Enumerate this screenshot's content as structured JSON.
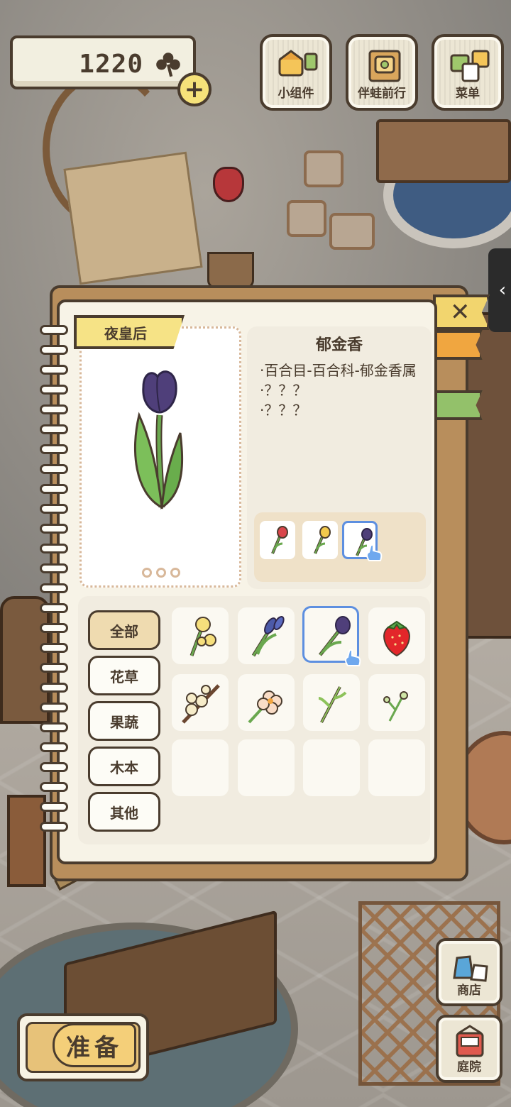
{
  "hud": {
    "clover_count": "1220",
    "plus_label": "+",
    "buttons": [
      {
        "label": "小组件",
        "icon": "widget-icon"
      },
      {
        "label": "伴蛙前行",
        "icon": "frog-journey-icon"
      },
      {
        "label": "菜单",
        "icon": "menu-icon"
      }
    ],
    "side_tab_label": "‹"
  },
  "notebook": {
    "close_label": "✕",
    "flower_name": "夜皇后",
    "info": {
      "title": "郁金香",
      "lines": [
        "·百合目-百合科-郁金香属",
        "·？？？",
        "·？？？"
      ]
    },
    "variants": [
      {
        "name": "red-tulip",
        "color": "#d9464b"
      },
      {
        "name": "yellow-tulip",
        "color": "#f2c94c"
      },
      {
        "name": "purple-tulip",
        "color": "#4f3f7a",
        "selected": true
      }
    ],
    "categories": [
      "全部",
      "花草",
      "果蔬",
      "木本",
      "其他"
    ],
    "active_category": "全部",
    "items": [
      {
        "name": "yellow-flower",
        "icon": "yellow-flower-icon"
      },
      {
        "name": "blue-iris",
        "icon": "iris-icon"
      },
      {
        "name": "tulip",
        "icon": "tulip-icon",
        "selected": true
      },
      {
        "name": "strawberry",
        "icon": "strawberry-icon"
      },
      {
        "name": "plum-blossom-branch",
        "icon": "plum-blossom-icon"
      },
      {
        "name": "peach-blossom",
        "icon": "peach-blossom-icon"
      },
      {
        "name": "grass-sprig",
        "icon": "grass-icon"
      },
      {
        "name": "sprout",
        "icon": "sprout-icon"
      }
    ]
  },
  "bottom": {
    "prepare_label": "准备",
    "shop_label": "商店",
    "garden_label": "庭院"
  },
  "colors": {
    "outline": "#4a3c2e",
    "paper": "#f7f3e7",
    "selection": "#5d8fe0",
    "ribbon": "#f6e386"
  }
}
